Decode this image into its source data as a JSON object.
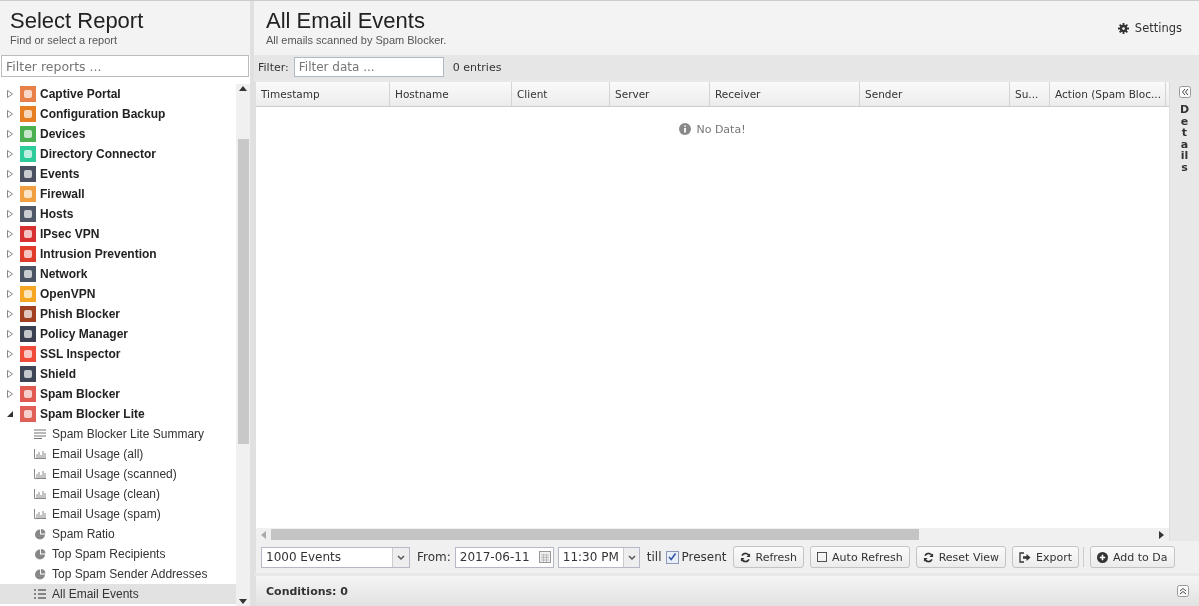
{
  "sidebar": {
    "title": "Select Report",
    "subtitle": "Find or select a report",
    "filter": {
      "placeholder": "Filter reports ..."
    },
    "items": [
      {
        "label": "Captive Portal",
        "color": "#e8804a",
        "expanded": false
      },
      {
        "label": "Configuration Backup",
        "color": "#e67e22",
        "expanded": false
      },
      {
        "label": "Devices",
        "color": "#4caf50",
        "expanded": false
      },
      {
        "label": "Directory Connector",
        "color": "#2ecc9a",
        "expanded": false
      },
      {
        "label": "Events",
        "color": "#4a5060",
        "expanded": false
      },
      {
        "label": "Firewall",
        "color": "#f0a040",
        "expanded": false
      },
      {
        "label": "Hosts",
        "color": "#505868",
        "expanded": false
      },
      {
        "label": "IPsec VPN",
        "color": "#d83030",
        "expanded": false
      },
      {
        "label": "Intrusion Prevention",
        "color": "#e03a2a",
        "expanded": false
      },
      {
        "label": "Network",
        "color": "#4a5464",
        "expanded": false
      },
      {
        "label": "OpenVPN",
        "color": "#f5a623",
        "expanded": false
      },
      {
        "label": "Phish Blocker",
        "color": "#a04020",
        "expanded": false
      },
      {
        "label": "Policy Manager",
        "color": "#3a4050",
        "expanded": false
      },
      {
        "label": "SSL Inspector",
        "color": "#f04a3a",
        "expanded": false
      },
      {
        "label": "Shield",
        "color": "#3e4656",
        "expanded": false
      },
      {
        "label": "Spam Blocker",
        "color": "#e05a50",
        "expanded": false
      },
      {
        "label": "Spam Blocker Lite",
        "color": "#e06058",
        "expanded": true,
        "children": [
          {
            "label": "Spam Blocker Lite Summary",
            "kind": "summary",
            "selected": false
          },
          {
            "label": "Email Usage (all)",
            "kind": "bar",
            "selected": false
          },
          {
            "label": "Email Usage (scanned)",
            "kind": "bar",
            "selected": false
          },
          {
            "label": "Email Usage (clean)",
            "kind": "bar",
            "selected": false
          },
          {
            "label": "Email Usage (spam)",
            "kind": "bar",
            "selected": false
          },
          {
            "label": "Spam Ratio",
            "kind": "pie",
            "selected": false
          },
          {
            "label": "Top Spam Recipients",
            "kind": "pie",
            "selected": false
          },
          {
            "label": "Top Spam Sender Addresses",
            "kind": "pie",
            "selected": false
          },
          {
            "label": "All Email Events",
            "kind": "list",
            "selected": true
          }
        ]
      }
    ]
  },
  "report": {
    "title": "All Email Events",
    "subtitle": "All emails scanned by Spam Blocker.",
    "settings": "Settings",
    "filter_label": "Filter:",
    "filter": {
      "placeholder": "Filter data ..."
    },
    "entries": "0 entries",
    "columns": [
      "Timestamp",
      "Hostname",
      "Client",
      "Server",
      "Receiver",
      "Sender",
      "Su...",
      "Action (Spam Bloc..."
    ],
    "empty": "No Data!",
    "details": "Details",
    "toolbar": {
      "limit": "1000 Events",
      "from_label": "From:",
      "date": "2017-06-11",
      "time": "11:30 PM",
      "till": "till",
      "present": {
        "label": "Present",
        "checked": true
      },
      "buttons": [
        {
          "label": "Refresh",
          "kind": "refresh"
        },
        {
          "label": "Auto Refresh",
          "kind": "check"
        },
        {
          "label": "Reset View",
          "kind": "refresh"
        },
        {
          "label": "Export",
          "kind": "export"
        },
        {
          "label": "Add to Da",
          "kind": "add"
        }
      ]
    },
    "conditions": "Conditions: 0"
  }
}
